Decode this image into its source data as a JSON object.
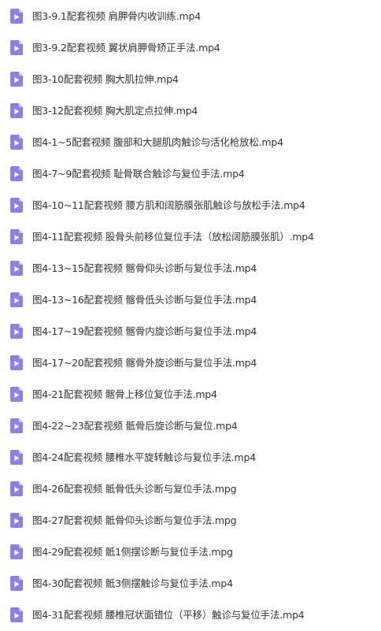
{
  "files": [
    {
      "name": "图3-9.1配套视频 肩胛骨内收训练.mp4"
    },
    {
      "name": "图3-9.2配套视频 翼状肩胛骨矫正手法.mp4"
    },
    {
      "name": "图3-10配套视频 胸大肌拉伸.mp4"
    },
    {
      "name": "图3-12配套视频 胸大肌定点拉伸.mp4"
    },
    {
      "name": "图4-1~5配套视频 腹部和大腿肌肉触诊与活化枪放松.mp4"
    },
    {
      "name": "图4-7~9配套视频 耻骨联合触诊与复位手法.mp4"
    },
    {
      "name": "图4-10~11配套视频 腰方肌和阔筋膜张肌触诊与放松手法.mp4"
    },
    {
      "name": "图4-11配套视频 股骨头前移位复位手法（放松阔筋膜张肌）.mp4"
    },
    {
      "name": "图4-13~15配套视频 髂骨仰头诊断与复位手法.mp4"
    },
    {
      "name": "图4-13~16配套视频 髂骨低头诊断与复位手法.mp4"
    },
    {
      "name": "图4-17~19配套视频 髂骨内旋诊断与复位手法.mp4"
    },
    {
      "name": "图4-17~20配套视频 髂骨外旋诊断与复位手法.mp4"
    },
    {
      "name": "图4-21配套视频 髂骨上移位复位手法.mp4"
    },
    {
      "name": "图4-22~23配套视频 骶骨后旋诊断与复位.mp4"
    },
    {
      "name": "图4-24配套视频 腰椎水平旋转触诊与复位手法.mp4"
    },
    {
      "name": "图4-26配套视频 骶骨低头诊断与复位手法.mpg"
    },
    {
      "name": "图4-27配套视频 骶骨仰头诊断与复位手法.mpg"
    },
    {
      "name": "图4-29配套视频 骶1侧摆诊断与复位手法.mpg"
    },
    {
      "name": "图4-30配套视频 骶3侧摆触诊与复位手法.mp4"
    },
    {
      "name": "图4-31配套视频 腰椎冠状面错位（平移）触诊与复位手法.mp4"
    }
  ],
  "icon": {
    "name": "video-file-icon",
    "body_color": "#8b80e8",
    "fold_color": "#c9c3f5",
    "play_color": "#ffffff"
  }
}
